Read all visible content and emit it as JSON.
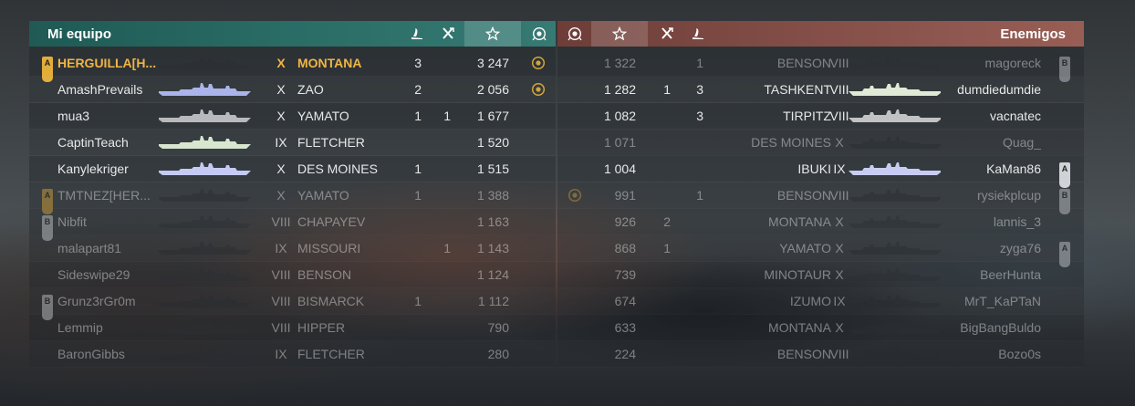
{
  "left_team": {
    "title": "Mi equipo",
    "header_icons": [
      "planes-destroyed-icon",
      "ship-kills-icon",
      "base-xp-star-icon",
      "achievement-medal-icon"
    ],
    "rows": [
      {
        "badge": "A",
        "badge_color": "#e2ad3a",
        "name": "HERGUILLA[H...",
        "tier": "X",
        "ship": "MONTANA",
        "kills": "3",
        "planes": "",
        "xp": "3 247",
        "medal": true,
        "me": true,
        "dim": false,
        "ship_tint": "#2c3034"
      },
      {
        "badge": "",
        "badge_color": "",
        "name": "AmashPrevails",
        "tier": "X",
        "ship": "ZAO",
        "kills": "2",
        "planes": "",
        "xp": "2 056",
        "medal": true,
        "me": false,
        "dim": false,
        "ship_tint": "#aab4ea"
      },
      {
        "badge": "",
        "badge_color": "",
        "name": "mua3",
        "tier": "X",
        "ship": "YAMATO",
        "kills": "1",
        "planes": "1",
        "xp": "1 677",
        "medal": false,
        "me": false,
        "dim": false,
        "ship_tint": "#b7b9bc"
      },
      {
        "badge": "",
        "badge_color": "",
        "name": "CaptinTeach",
        "tier": "IX",
        "ship": "FLETCHER",
        "kills": "",
        "planes": "",
        "xp": "1 520",
        "medal": false,
        "me": false,
        "dim": false,
        "ship_tint": "#d8e6cf"
      },
      {
        "badge": "",
        "badge_color": "",
        "name": "Kanylekriger",
        "tier": "X",
        "ship": "DES MOINES",
        "kills": "1",
        "planes": "",
        "xp": "1 515",
        "medal": false,
        "me": false,
        "dim": false,
        "ship_tint": "#c4caf3"
      },
      {
        "badge": "A",
        "badge_color": "#e2ad3a",
        "name": "TMTNEZ[HER...",
        "tier": "X",
        "ship": "YAMATO",
        "kills": "1",
        "planes": "",
        "xp": "1 388",
        "medal": false,
        "me": false,
        "dim": true,
        "ship_tint": "#2c3034"
      },
      {
        "badge": "B",
        "badge_color": "#cfd3d6",
        "name": "Nibfit",
        "tier": "VIII",
        "ship": "CHAPAYEV",
        "kills": "",
        "planes": "",
        "xp": "1 163",
        "medal": false,
        "me": false,
        "dim": true,
        "ship_tint": "#2c3034"
      },
      {
        "badge": "",
        "badge_color": "",
        "name": "malapart81",
        "tier": "IX",
        "ship": "MISSOURI",
        "kills": "",
        "planes": "1",
        "xp": "1 143",
        "medal": false,
        "me": false,
        "dim": true,
        "ship_tint": "#2c3034"
      },
      {
        "badge": "",
        "badge_color": "",
        "name": "Sideswipe29",
        "tier": "VIII",
        "ship": "BENSON",
        "kills": "",
        "planes": "",
        "xp": "1 124",
        "medal": false,
        "me": false,
        "dim": true,
        "ship_tint": "#2c3034"
      },
      {
        "badge": "B",
        "badge_color": "#cfd3d6",
        "name": "Grunz3rGr0m",
        "tier": "VIII",
        "ship": "BISMARCK",
        "kills": "1",
        "planes": "",
        "xp": "1 112",
        "medal": false,
        "me": false,
        "dim": true,
        "ship_tint": "#2c3034"
      },
      {
        "badge": "",
        "badge_color": "",
        "name": "Lemmip",
        "tier": "VIII",
        "ship": "HIPPER",
        "kills": "",
        "planes": "",
        "xp": "790",
        "medal": false,
        "me": false,
        "dim": true,
        "ship_tint": "#2c3034"
      },
      {
        "badge": "",
        "badge_color": "",
        "name": "BaronGibbs",
        "tier": "IX",
        "ship": "FLETCHER",
        "kills": "",
        "planes": "",
        "xp": "280",
        "medal": false,
        "me": false,
        "dim": true,
        "ship_tint": "#2c3034"
      }
    ]
  },
  "right_team": {
    "title": "Enemigos",
    "header_icons": [
      "achievement-medal-icon",
      "base-xp-star-icon",
      "ship-kills-icon",
      "planes-destroyed-icon"
    ],
    "rows": [
      {
        "badge": "B",
        "badge_color": "#cfd3d6",
        "name": "magoreck",
        "tier": "VIII",
        "ship": "BENSON",
        "kills": "1",
        "planes": "",
        "xp": "1 322",
        "medal": false,
        "dim": true,
        "ship_tint": "#2c3034"
      },
      {
        "badge": "",
        "badge_color": "",
        "name": "dumdiedumdie",
        "tier": "VIII",
        "ship": "TASHKENT",
        "kills": "3",
        "planes": "1",
        "xp": "1 282",
        "medal": false,
        "dim": false,
        "ship_tint": "#dfe9d5"
      },
      {
        "badge": "",
        "badge_color": "",
        "name": "vacnatec",
        "tier": "VIII",
        "ship": "TIRPITZ",
        "kills": "3",
        "planes": "",
        "xp": "1 082",
        "medal": false,
        "dim": false,
        "ship_tint": "#c0c2c4"
      },
      {
        "badge": "",
        "badge_color": "",
        "name": "Quag_",
        "tier": "X",
        "ship": "DES MOINES",
        "kills": "",
        "planes": "",
        "xp": "1 071",
        "medal": false,
        "dim": true,
        "ship_tint": "#2c3034"
      },
      {
        "badge": "A",
        "badge_color": "#cfd3d6",
        "name": "KaMan86",
        "tier": "IX",
        "ship": "IBUKI",
        "kills": "",
        "planes": "",
        "xp": "1 004",
        "medal": false,
        "dim": false,
        "ship_tint": "#c8ccf2"
      },
      {
        "badge": "B",
        "badge_color": "#cfd3d6",
        "name": "rysiekplcup",
        "tier": "VIII",
        "ship": "BENSON",
        "kills": "1",
        "planes": "",
        "xp": "991",
        "medal": true,
        "dim": true,
        "ship_tint": "#2c3034"
      },
      {
        "badge": "",
        "badge_color": "",
        "name": "lannis_3",
        "tier": "X",
        "ship": "MONTANA",
        "kills": "",
        "planes": "2",
        "xp": "926",
        "medal": false,
        "dim": true,
        "ship_tint": "#2c3034"
      },
      {
        "badge": "A",
        "badge_color": "#cfd3d6",
        "name": "zyga76",
        "tier": "X",
        "ship": "YAMATO",
        "kills": "",
        "planes": "1",
        "xp": "868",
        "medal": false,
        "dim": true,
        "ship_tint": "#2c3034"
      },
      {
        "badge": "",
        "badge_color": "",
        "name": "BeerHunta",
        "tier": "X",
        "ship": "MINOTAUR",
        "kills": "",
        "planes": "",
        "xp": "739",
        "medal": false,
        "dim": true,
        "ship_tint": "#2c3034"
      },
      {
        "badge": "",
        "badge_color": "",
        "name": "MrT_KaPTaN",
        "tier": "IX",
        "ship": "IZUMO",
        "kills": "",
        "planes": "",
        "xp": "674",
        "medal": false,
        "dim": true,
        "ship_tint": "#2c3034"
      },
      {
        "badge": "",
        "badge_color": "",
        "name": "BigBangBuldo",
        "tier": "X",
        "ship": "MONTANA",
        "kills": "",
        "planes": "",
        "xp": "633",
        "medal": false,
        "dim": true,
        "ship_tint": "#2c3034"
      },
      {
        "badge": "",
        "badge_color": "",
        "name": "Bozo0s",
        "tier": "VIII",
        "ship": "BENSON",
        "kills": "",
        "planes": "",
        "xp": "224",
        "medal": false,
        "dim": true,
        "ship_tint": "#2c3034"
      }
    ]
  }
}
